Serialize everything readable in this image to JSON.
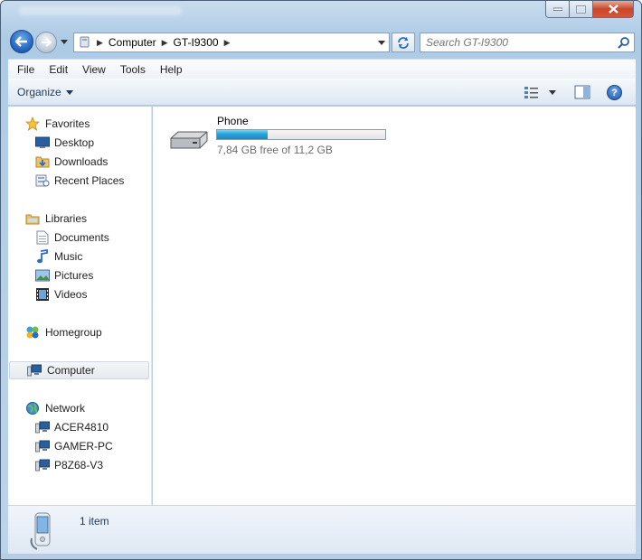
{
  "window": {
    "accent_color": "#1f5fb8"
  },
  "caption_buttons": {
    "minimize_icon": "minimize-icon",
    "maximize_icon": "maximize-icon",
    "close_icon": "close-icon"
  },
  "address_bar": {
    "crumbs": [
      "Computer",
      "GT-I9300"
    ]
  },
  "search": {
    "placeholder": "Search GT-I9300"
  },
  "menu": {
    "items": [
      "File",
      "Edit",
      "View",
      "Tools",
      "Help"
    ]
  },
  "toolbar": {
    "organize_label": "Organize",
    "help_label": "?"
  },
  "navigation": {
    "favorites": {
      "label": "Favorites",
      "items": [
        "Desktop",
        "Downloads",
        "Recent Places"
      ]
    },
    "libraries": {
      "label": "Libraries",
      "items": [
        "Documents",
        "Music",
        "Pictures",
        "Videos"
      ]
    },
    "homegroup": {
      "label": "Homegroup"
    },
    "computer": {
      "label": "Computer"
    },
    "network": {
      "label": "Network",
      "items": [
        "ACER4810",
        "GAMER-PC",
        "P8Z68-V3"
      ]
    }
  },
  "content": {
    "drive": {
      "name": "Phone",
      "space_text": "7,84 GB free of 11,2 GB",
      "used_fraction": 0.3
    }
  },
  "details": {
    "count_text": "1 item"
  }
}
